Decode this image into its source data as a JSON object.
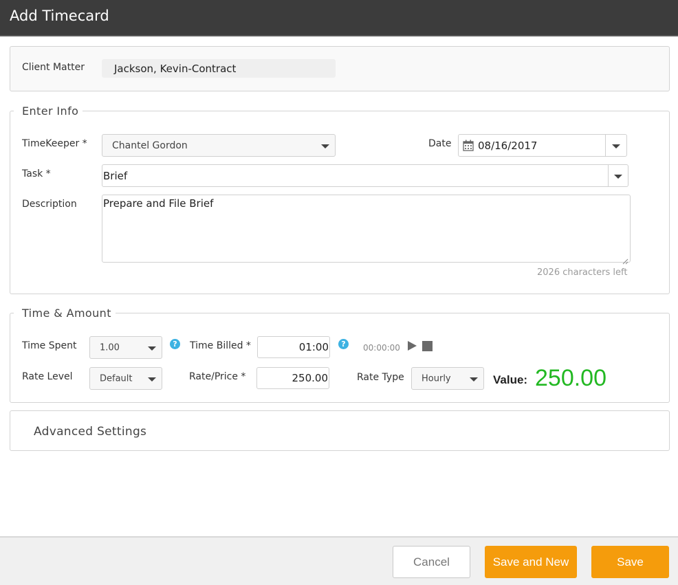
{
  "window": {
    "title": "Add Timecard"
  },
  "client_matter": {
    "label": "Client Matter",
    "value": "Jackson, Kevin-Contract"
  },
  "enter_info": {
    "legend": "Enter Info",
    "timekeeper_label": "TimeKeeper *",
    "timekeeper_value": "Chantel Gordon",
    "date_label": "Date",
    "date_value": "08/16/2017",
    "task_label": "Task *",
    "task_value": "Brief",
    "description_label": "Description",
    "description_value": "Prepare and File Brief",
    "chars_left": "2026 characters left"
  },
  "time_amount": {
    "legend": "Time & Amount",
    "time_spent_label": "Time Spent",
    "time_spent_value": "1.00",
    "time_billed_label": "Time Billed *",
    "time_billed_value": "01:00",
    "timer_display": "00:00:00",
    "rate_level_label": "Rate Level",
    "rate_level_value": "Default",
    "rate_price_label": "Rate/Price *",
    "rate_price_value": "250.00",
    "rate_type_label": "Rate Type",
    "rate_type_value": "Hourly",
    "value_label": "Value:",
    "value_amount": "250.00"
  },
  "advanced": {
    "label": "Advanced Settings"
  },
  "footer": {
    "cancel_label": "Cancel",
    "save_new_label": "Save and New",
    "save_label": "Save"
  },
  "icons": {
    "help": "question-circle-icon",
    "calendar": "calendar-icon",
    "play": "play-icon",
    "stop": "stop-icon",
    "dropdown": "caret-down-icon"
  },
  "colors": {
    "header_bg": "#3c3c3c",
    "primary_button": "#f59c0c",
    "value_green": "#22b822",
    "help_icon": "#3db2e2"
  }
}
